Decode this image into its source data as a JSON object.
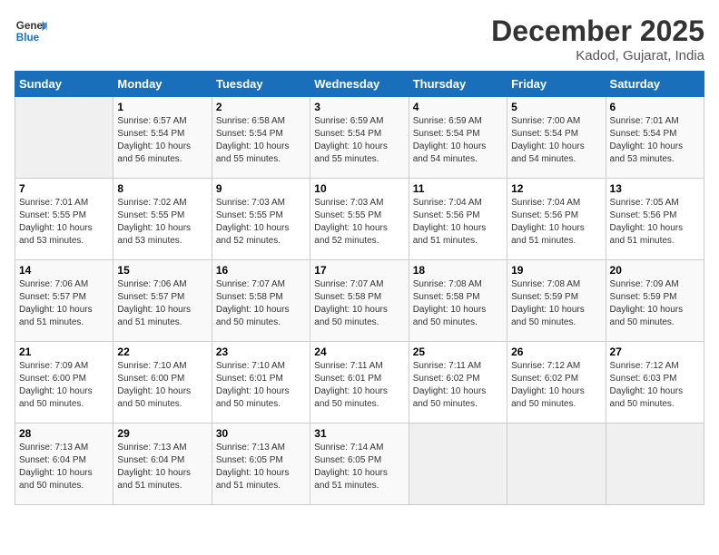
{
  "header": {
    "logo_line1": "General",
    "logo_line2": "Blue",
    "month": "December 2025",
    "location": "Kadod, Gujarat, India"
  },
  "days_of_week": [
    "Sunday",
    "Monday",
    "Tuesday",
    "Wednesday",
    "Thursday",
    "Friday",
    "Saturday"
  ],
  "weeks": [
    [
      {
        "day": "",
        "empty": true
      },
      {
        "day": "1",
        "sunrise": "6:57 AM",
        "sunset": "5:54 PM",
        "daylight": "10 hours and 56 minutes."
      },
      {
        "day": "2",
        "sunrise": "6:58 AM",
        "sunset": "5:54 PM",
        "daylight": "10 hours and 55 minutes."
      },
      {
        "day": "3",
        "sunrise": "6:59 AM",
        "sunset": "5:54 PM",
        "daylight": "10 hours and 55 minutes."
      },
      {
        "day": "4",
        "sunrise": "6:59 AM",
        "sunset": "5:54 PM",
        "daylight": "10 hours and 54 minutes."
      },
      {
        "day": "5",
        "sunrise": "7:00 AM",
        "sunset": "5:54 PM",
        "daylight": "10 hours and 54 minutes."
      },
      {
        "day": "6",
        "sunrise": "7:01 AM",
        "sunset": "5:54 PM",
        "daylight": "10 hours and 53 minutes."
      }
    ],
    [
      {
        "day": "7",
        "sunrise": "7:01 AM",
        "sunset": "5:55 PM",
        "daylight": "10 hours and 53 minutes."
      },
      {
        "day": "8",
        "sunrise": "7:02 AM",
        "sunset": "5:55 PM",
        "daylight": "10 hours and 53 minutes."
      },
      {
        "day": "9",
        "sunrise": "7:03 AM",
        "sunset": "5:55 PM",
        "daylight": "10 hours and 52 minutes."
      },
      {
        "day": "10",
        "sunrise": "7:03 AM",
        "sunset": "5:55 PM",
        "daylight": "10 hours and 52 minutes."
      },
      {
        "day": "11",
        "sunrise": "7:04 AM",
        "sunset": "5:56 PM",
        "daylight": "10 hours and 51 minutes."
      },
      {
        "day": "12",
        "sunrise": "7:04 AM",
        "sunset": "5:56 PM",
        "daylight": "10 hours and 51 minutes."
      },
      {
        "day": "13",
        "sunrise": "7:05 AM",
        "sunset": "5:56 PM",
        "daylight": "10 hours and 51 minutes."
      }
    ],
    [
      {
        "day": "14",
        "sunrise": "7:06 AM",
        "sunset": "5:57 PM",
        "daylight": "10 hours and 51 minutes."
      },
      {
        "day": "15",
        "sunrise": "7:06 AM",
        "sunset": "5:57 PM",
        "daylight": "10 hours and 51 minutes."
      },
      {
        "day": "16",
        "sunrise": "7:07 AM",
        "sunset": "5:58 PM",
        "daylight": "10 hours and 50 minutes."
      },
      {
        "day": "17",
        "sunrise": "7:07 AM",
        "sunset": "5:58 PM",
        "daylight": "10 hours and 50 minutes."
      },
      {
        "day": "18",
        "sunrise": "7:08 AM",
        "sunset": "5:58 PM",
        "daylight": "10 hours and 50 minutes."
      },
      {
        "day": "19",
        "sunrise": "7:08 AM",
        "sunset": "5:59 PM",
        "daylight": "10 hours and 50 minutes."
      },
      {
        "day": "20",
        "sunrise": "7:09 AM",
        "sunset": "5:59 PM",
        "daylight": "10 hours and 50 minutes."
      }
    ],
    [
      {
        "day": "21",
        "sunrise": "7:09 AM",
        "sunset": "6:00 PM",
        "daylight": "10 hours and 50 minutes."
      },
      {
        "day": "22",
        "sunrise": "7:10 AM",
        "sunset": "6:00 PM",
        "daylight": "10 hours and 50 minutes."
      },
      {
        "day": "23",
        "sunrise": "7:10 AM",
        "sunset": "6:01 PM",
        "daylight": "10 hours and 50 minutes."
      },
      {
        "day": "24",
        "sunrise": "7:11 AM",
        "sunset": "6:01 PM",
        "daylight": "10 hours and 50 minutes."
      },
      {
        "day": "25",
        "sunrise": "7:11 AM",
        "sunset": "6:02 PM",
        "daylight": "10 hours and 50 minutes."
      },
      {
        "day": "26",
        "sunrise": "7:12 AM",
        "sunset": "6:02 PM",
        "daylight": "10 hours and 50 minutes."
      },
      {
        "day": "27",
        "sunrise": "7:12 AM",
        "sunset": "6:03 PM",
        "daylight": "10 hours and 50 minutes."
      }
    ],
    [
      {
        "day": "28",
        "sunrise": "7:13 AM",
        "sunset": "6:04 PM",
        "daylight": "10 hours and 50 minutes."
      },
      {
        "day": "29",
        "sunrise": "7:13 AM",
        "sunset": "6:04 PM",
        "daylight": "10 hours and 51 minutes."
      },
      {
        "day": "30",
        "sunrise": "7:13 AM",
        "sunset": "6:05 PM",
        "daylight": "10 hours and 51 minutes."
      },
      {
        "day": "31",
        "sunrise": "7:14 AM",
        "sunset": "6:05 PM",
        "daylight": "10 hours and 51 minutes."
      },
      {
        "day": "",
        "empty": true
      },
      {
        "day": "",
        "empty": true
      },
      {
        "day": "",
        "empty": true
      }
    ]
  ]
}
